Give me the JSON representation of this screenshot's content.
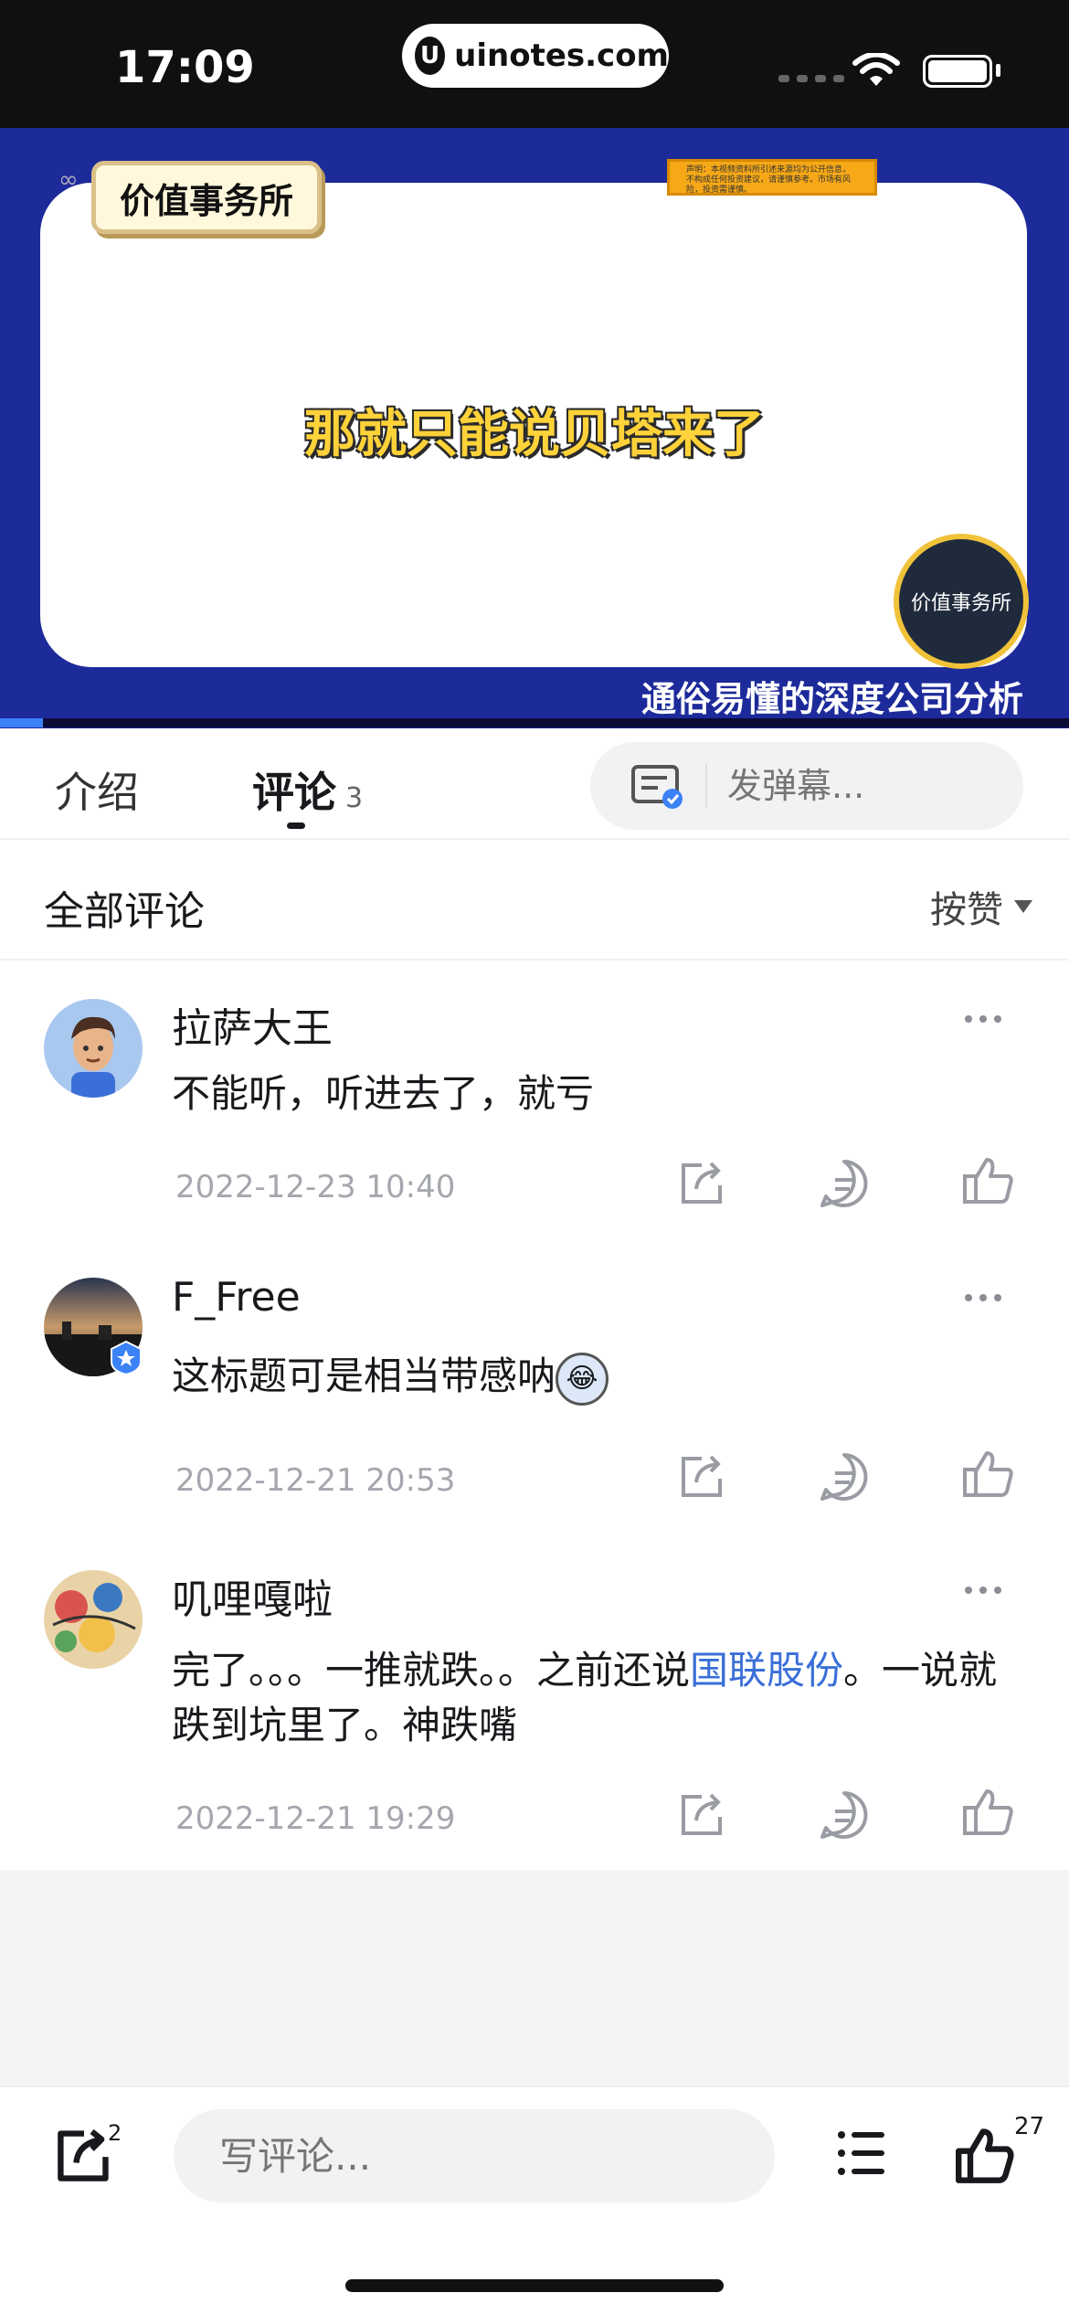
{
  "status_bar": {
    "time": "17:09",
    "url": "uinotes.com",
    "url_logo": "U"
  },
  "video": {
    "brand_tag": "价值事务所",
    "banner_text": "声明：本视频资料所引述来源均为公开信息，不构成任何投资建议，请谨慎参考。市场有风险，投资需谨慎。",
    "subtitle": "那就只能说贝塔来了",
    "round_logo": "价值事务所",
    "slogan": "通俗易懂的深度公司分析",
    "progress": 0.04
  },
  "tabs": {
    "intro": "介绍",
    "comments": "评论",
    "comments_count": "3",
    "danmaku_placeholder": "发弹幕..."
  },
  "comments_header": {
    "title": "全部评论",
    "sort": "按赞"
  },
  "comments": [
    {
      "user": "拉萨大王",
      "text": "不能听，听进去了，就亏",
      "date": "2022-12-23 10:40"
    },
    {
      "user": "F_Free",
      "text": "这标题可是相当带感呐",
      "emoji": "😂",
      "date": "2022-12-21 20:53"
    },
    {
      "user": "叽哩嘎啦",
      "text_before": "完了。。。一推就跌。。之前还说",
      "link": "国联股份",
      "text_after": "。一说就跌到坑里了。神跌嘴",
      "date": "2022-12-21 19:29"
    }
  ],
  "bottom_bar": {
    "share_count": "2",
    "comment_placeholder": "写评论...",
    "like_count": "27"
  },
  "colors": {
    "accent": "#3a6fd8",
    "video_bg": "#1d2a9a",
    "subtitle": "#ffd23a"
  },
  "icons": [
    "share-icon",
    "reply-icon",
    "like-icon",
    "more-icon",
    "list-icon",
    "danmaku-icon",
    "wifi-icon",
    "battery-icon"
  ]
}
